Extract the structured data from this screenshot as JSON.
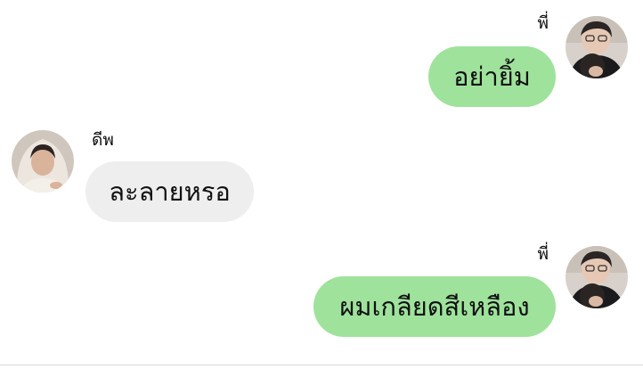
{
  "messages": [
    {
      "sender": "พี่",
      "text": "อย่ายิ้ม",
      "direction": "outgoing"
    },
    {
      "sender": "ดีพ",
      "text": "ละลายหรอ",
      "direction": "incoming"
    },
    {
      "sender": "พี่",
      "text": "ผมเกลียดสีเหลือง",
      "direction": "outgoing"
    }
  ],
  "colors": {
    "outgoing_bubble": "#9fe29c",
    "incoming_bubble": "#eeeeee",
    "background": "#ffffff",
    "text": "#111111"
  }
}
